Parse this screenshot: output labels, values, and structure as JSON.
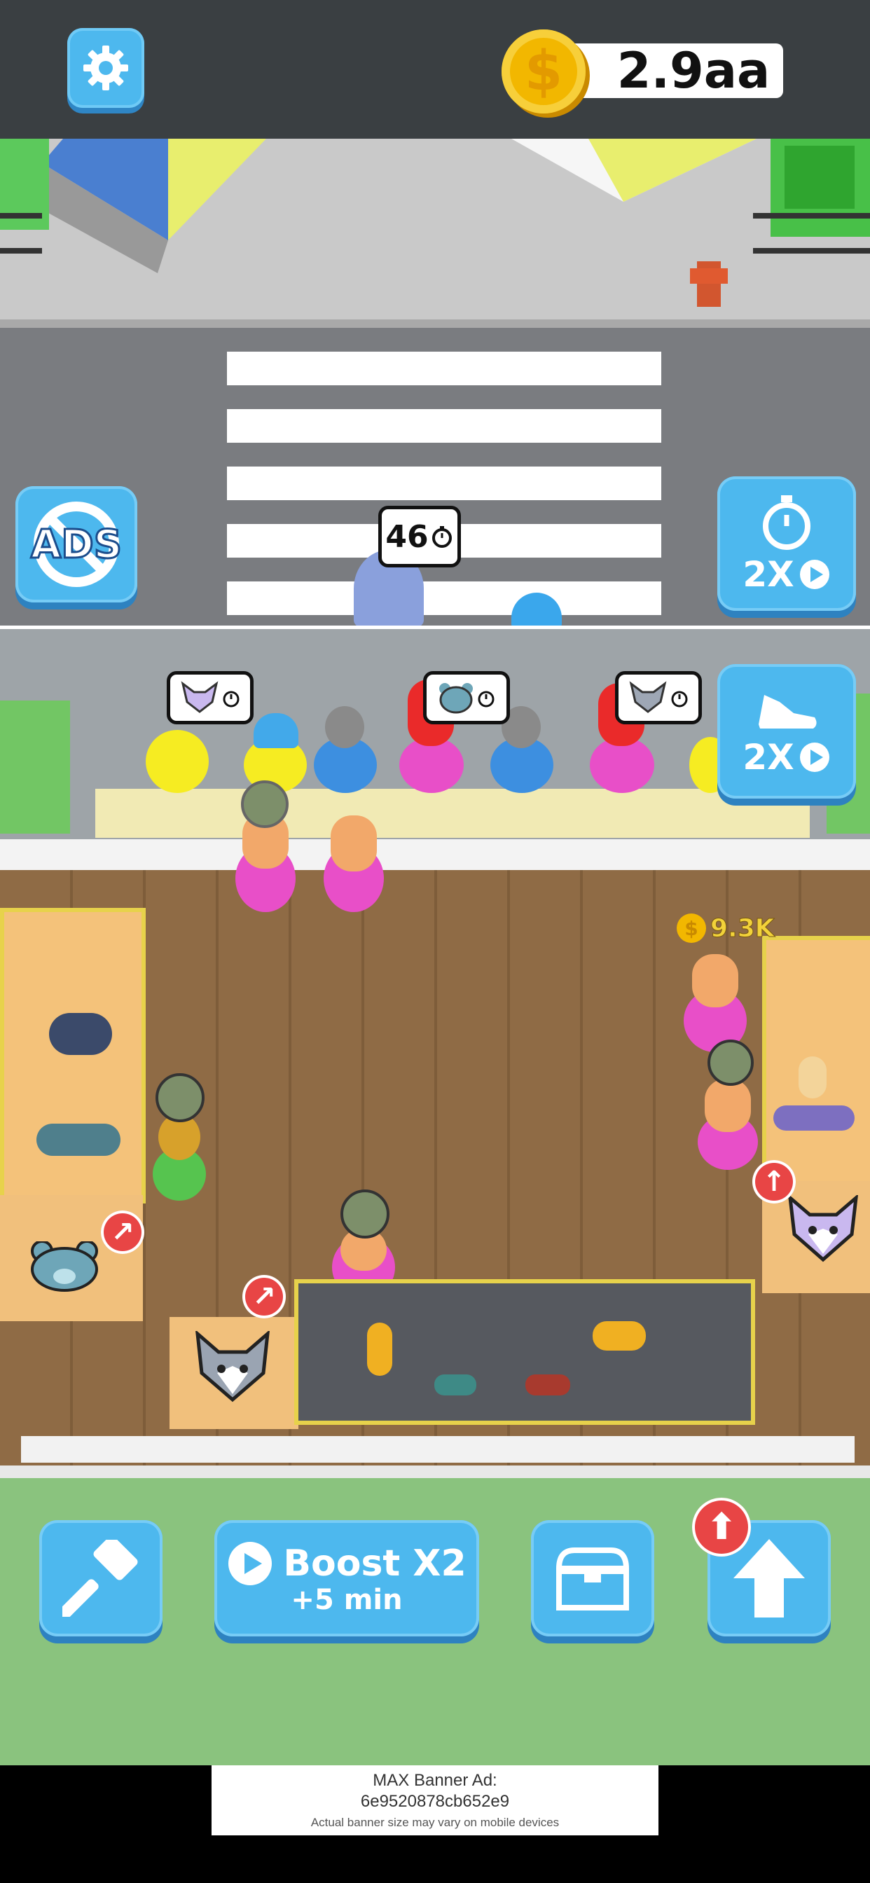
{
  "currency": {
    "amount": "2.9aa",
    "symbol": "$"
  },
  "buttons": {
    "ads_label": "ADS",
    "speed_label": "2X",
    "move_label": "2X",
    "boost_title": "Boost X2",
    "boost_subtitle": "+5 min"
  },
  "timer_bubble": {
    "value": "46"
  },
  "earnings": {
    "value": "9.3K",
    "symbol": "$"
  },
  "ad_banner": {
    "title": "MAX Banner Ad:",
    "id": "6e9520878cb652e9",
    "note": "Actual banner size may vary on mobile devices"
  },
  "colors": {
    "primary_button": "#4db8ee",
    "coin": "#f2b700",
    "alert": "#e84545",
    "grass": "#8ac37e"
  }
}
